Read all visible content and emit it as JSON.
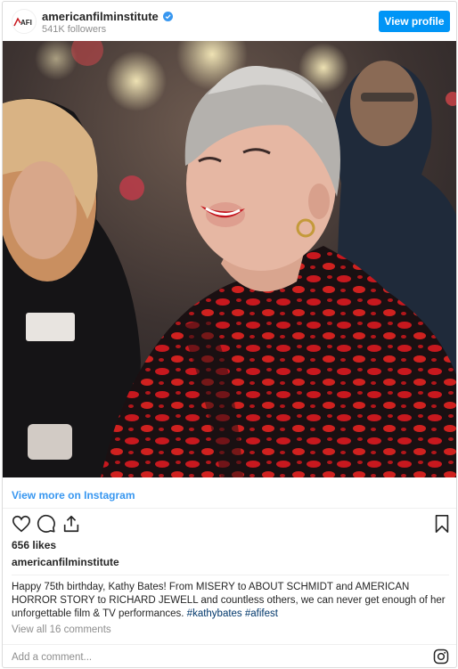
{
  "header": {
    "logo_text": "AFI",
    "account_name": "americanfilminstitute",
    "followers": "541K followers",
    "view_profile_label": "View profile"
  },
  "photo": {
    "alt": "Photo of a smiling woman with short grey hair in a red and black patterned jacket"
  },
  "view_more_label": "View more on Instagram",
  "actions": {
    "like_icon": "heart-icon",
    "comment_icon": "comment-icon",
    "share_icon": "share-icon",
    "save_icon": "bookmark-icon"
  },
  "likes": "656 likes",
  "caption": {
    "username": "americanfilminstitute",
    "text": "Happy 75th birthday, Kathy Bates! From MISERY to ABOUT SCHMIDT and AMERICAN HORROR STORY to RICHARD JEWELL and countless others, we can never get enough of her unforgettable film & TV performances.",
    "hashtag_1": "#kathybates",
    "hashtag_2": "#afifest"
  },
  "view_comments": "View all 16 comments",
  "comment_placeholder": "Add a comment...",
  "colors": {
    "accent": "#0095f6",
    "link": "#3897f0",
    "jacket_red": "#c8181e"
  }
}
